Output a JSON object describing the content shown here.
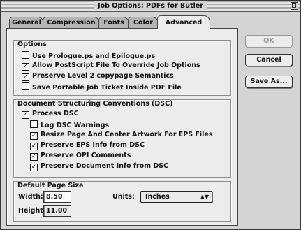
{
  "window": {
    "title": "Job Options: PDFs for Butler"
  },
  "tabs": [
    {
      "label": "General",
      "active": false
    },
    {
      "label": "Compression",
      "active": false
    },
    {
      "label": "Fonts",
      "active": false
    },
    {
      "label": "Color",
      "active": false
    },
    {
      "label": "Advanced",
      "active": true
    }
  ],
  "options": {
    "title": "Options",
    "items": [
      {
        "label": "Use Prologue.ps and Epilogue.ps",
        "checked": false
      },
      {
        "label": "Allow PostScript File To Override Job Options",
        "checked": true
      },
      {
        "label": "Preserve Level 2 copypage Semantics",
        "checked": true
      },
      {
        "label": "Save Portable Job Ticket Inside PDF File",
        "checked": false
      }
    ]
  },
  "dsc": {
    "title": "Document Structuring Conventions (DSC)",
    "process": {
      "label": "Process DSC",
      "checked": true
    },
    "items": [
      {
        "label": "Log DSC Warnings",
        "checked": false
      },
      {
        "label": "Resize Page And Center Artwork For EPS Files",
        "checked": true
      },
      {
        "label": "Preserve EPS Info from DSC",
        "checked": true
      },
      {
        "label": "Preserve OPI Comments",
        "checked": true
      },
      {
        "label": "Preserve Document Info from DSC",
        "checked": true
      }
    ]
  },
  "page_size": {
    "title": "Default Page Size",
    "width_label": "Width:",
    "width_value": "8.50",
    "height_label": "Height:",
    "height_value": "11.00",
    "units_label": "Units:",
    "units_value": "Inches"
  },
  "buttons": {
    "ok": "OK",
    "cancel": "Cancel",
    "save_as": "Save As..."
  }
}
